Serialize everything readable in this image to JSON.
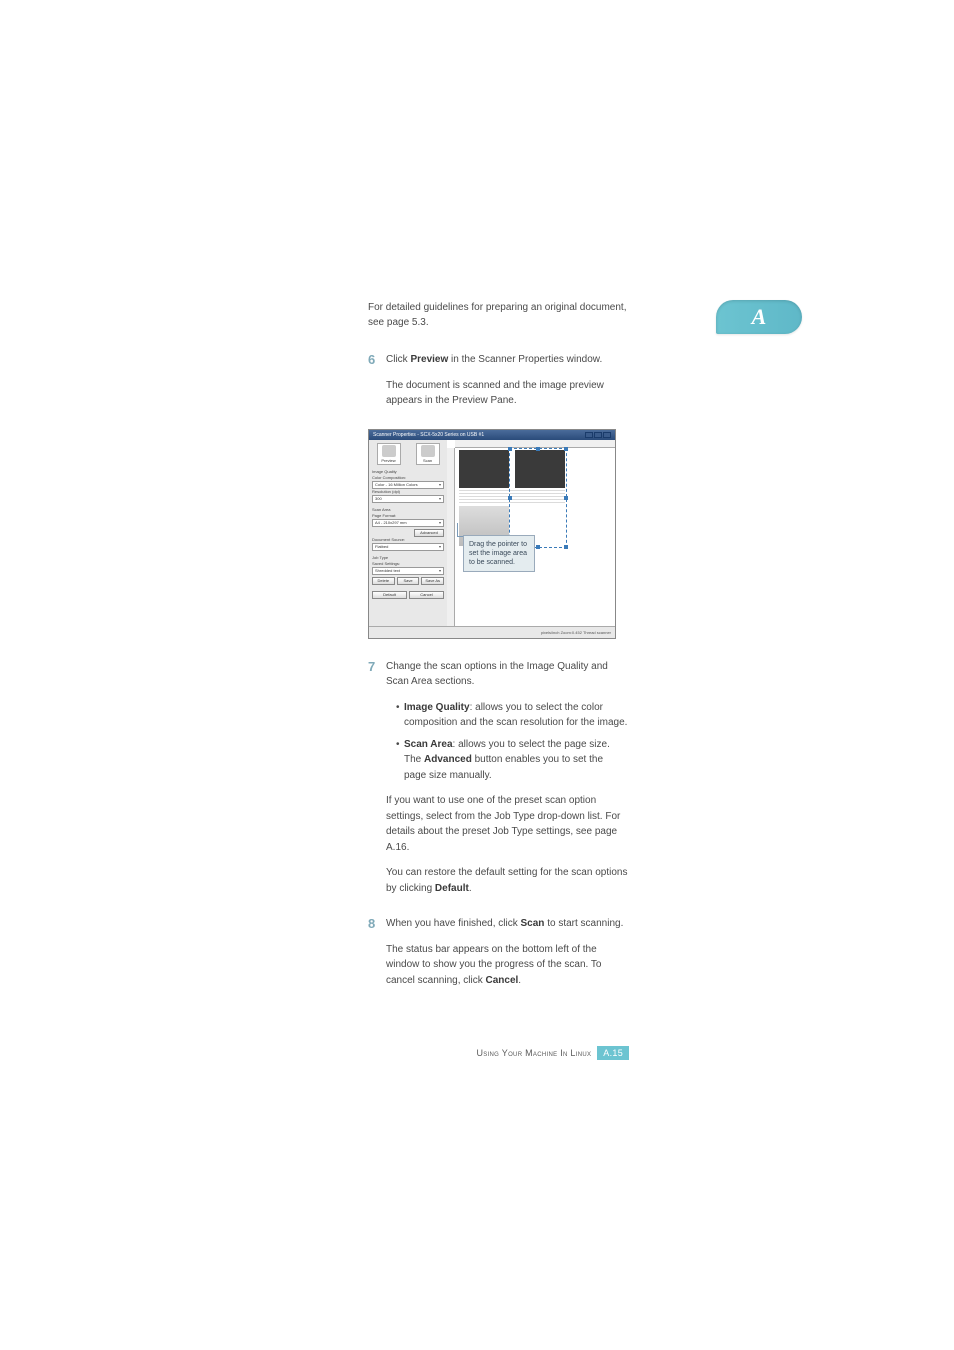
{
  "appendix_letter": "A",
  "intro": {
    "line1": "For detailed guidelines for preparing an original document,",
    "line2": "see page 5.3."
  },
  "step6": {
    "num": "6",
    "line1": "Click ",
    "bold1": "Preview",
    "line1_cont": " in the Scanner Properties window.",
    "line2": "The document is scanned and the image preview appears in the Preview Pane."
  },
  "screenshot": {
    "title": "Scanner Properties - SCX-5x20 Series on USB #1",
    "icons": {
      "preview": "Preview",
      "scan": "Scan"
    },
    "image_quality_section": "Image Quality",
    "color_comp_label": "Color Composition:",
    "color_comp_value": "Color - 16 Million Colors",
    "resolution_label": "Resolution (dpi)",
    "resolution_value": "300",
    "scan_area_section": "Scan Area",
    "page_format_label": "Page Format:",
    "page_format_value": "A4 - 210x297 mm",
    "advanced_btn": "Advanced",
    "doc_source_label": "Document Source:",
    "doc_source_value": "Flatbed",
    "job_type_section": "Job Type",
    "saved_settings_label": "Saved Settings:",
    "saved_settings_value": "Shredded text",
    "btn_delete": "Delete",
    "btn_save": "Save",
    "btn_saveas": "Save As",
    "btn_default": "Default",
    "btn_cancel": "Cancel",
    "status": "pixels/inch            Zoom:0.452  Thread scanner"
  },
  "callout": "Drag the pointer to set the image area to be scanned.",
  "step7": {
    "num": "7",
    "line1": "Change the scan options in the Image Quality and Scan Area sections.",
    "bullets": [
      {
        "bold": "Image Quality",
        "text": ": allows you to select the color composition and the scan resolution for the image."
      },
      {
        "bold": "Scan Area",
        "text_a": ": allows you to select the page size. The ",
        "bold2": "Advanced",
        "text_b": " button enables you to set the page size manually."
      }
    ],
    "para2": "If you want to use one of the preset scan option settings, select from the Job Type drop-down list. For details about the preset Job Type settings, see page A.16.",
    "para3_a": "You can restore the default setting for the scan options by clicking ",
    "para3_bold": "Default",
    "para3_b": "."
  },
  "step8": {
    "num": "8",
    "line1_a": "When you have finished, click ",
    "line1_bold": "Scan",
    "line1_b": " to start scanning.",
    "para2_a": "The status bar appears on the bottom left of the window to show you the progress of the scan. To cancel scanning, click ",
    "para2_bold": "Cancel",
    "para2_b": "."
  },
  "footer": {
    "text": "Using Your Machine In Linux",
    "page": "A.15"
  }
}
